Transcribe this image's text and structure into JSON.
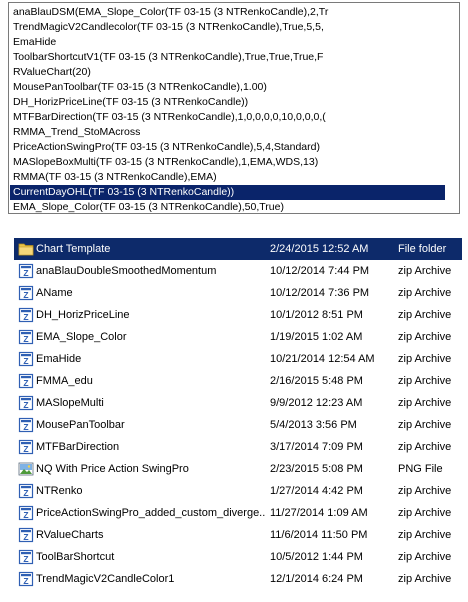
{
  "indicator_list": {
    "items": [
      "anaBlauDSM(EMA_Slope_Color(TF 03-15 (3 NTRenkoCandle),2,Tr",
      "TrendMagicV2Candlecolor(TF 03-15 (3 NTRenkoCandle),True,5,5,",
      "EmaHide",
      "ToolbarShortcutV1(TF 03-15 (3 NTRenkoCandle),True,True,True,F",
      "RValueChart(20)",
      "MousePanToolbar(TF 03-15 (3 NTRenkoCandle),1.00)",
      "DH_HorizPriceLine(TF 03-15 (3 NTRenkoCandle))",
      "MTFBarDirection(TF 03-15 (3 NTRenkoCandle),1,0,0,0,0,10,0,0,0,(",
      "RMMA_Trend_StoMAcross",
      "PriceActionSwingPro(TF 03-15 (3 NTRenkoCandle),5,4,Standard)",
      "MASlopeBoxMulti(TF 03-15 (3 NTRenkoCandle),1,EMA,WDS,13)",
      "RMMA(TF 03-15 (3 NTRenkoCandle),EMA)",
      "CurrentDayOHL(TF 03-15 (3 NTRenkoCandle))",
      "EMA_Slope_Color(TF 03-15 (3 NTRenkoCandle),50,True)"
    ],
    "selected_index": 12
  },
  "files": [
    {
      "name": "Chart Template",
      "date": "2/24/2015 12:52 AM",
      "type": "File folder",
      "icon": "folder-icon",
      "selected": true
    },
    {
      "name": "anaBlauDoubleSmoothedMomentum",
      "date": "10/12/2014 7:44 PM",
      "type": "zip Archive",
      "icon": "zip-archive-icon"
    },
    {
      "name": "AName",
      "date": "10/12/2014 7:36 PM",
      "type": "zip Archive",
      "icon": "zip-archive-icon"
    },
    {
      "name": "DH_HorizPriceLine",
      "date": "10/1/2012 8:51 PM",
      "type": "zip Archive",
      "icon": "zip-archive-icon"
    },
    {
      "name": "EMA_Slope_Color",
      "date": "1/19/2015 1:02 AM",
      "type": "zip Archive",
      "icon": "zip-archive-icon"
    },
    {
      "name": "EmaHide",
      "date": "10/21/2014 12:54 AM",
      "type": "zip Archive",
      "icon": "zip-archive-icon"
    },
    {
      "name": "FMMA_edu",
      "date": "2/16/2015 5:48 PM",
      "type": "zip Archive",
      "icon": "zip-archive-icon"
    },
    {
      "name": "MASlopeMulti",
      "date": "9/9/2012 12:23 AM",
      "type": "zip Archive",
      "icon": "zip-archive-icon"
    },
    {
      "name": "MousePanToolbar",
      "date": "5/4/2013 3:56 PM",
      "type": "zip Archive",
      "icon": "zip-archive-icon"
    },
    {
      "name": "MTFBarDirection",
      "date": "3/17/2014 7:09 PM",
      "type": "zip Archive",
      "icon": "zip-archive-icon"
    },
    {
      "name": "NQ With Price Action SwingPro",
      "date": "2/23/2015 5:08 PM",
      "type": "PNG File",
      "icon": "png-image-icon"
    },
    {
      "name": "NTRenko",
      "date": "1/27/2014 4:42 PM",
      "type": "zip Archive",
      "icon": "zip-archive-icon"
    },
    {
      "name": "PriceActionSwingPro_added_custom_diverge...",
      "date": "11/27/2014 1:09 AM",
      "type": "zip Archive",
      "icon": "zip-archive-icon"
    },
    {
      "name": "RValueCharts",
      "date": "11/6/2014 11:50 PM",
      "type": "zip Archive",
      "icon": "zip-archive-icon"
    },
    {
      "name": "ToolBarShortcut",
      "date": "10/5/2012 1:44 PM",
      "type": "zip Archive",
      "icon": "zip-archive-icon"
    },
    {
      "name": "TrendMagicV2CandleColor1",
      "date": "12/1/2014 6:24 PM",
      "type": "zip Archive",
      "icon": "zip-archive-icon"
    }
  ],
  "colors": {
    "selection": "#0a246a",
    "folder_yellow": "#e8c34a",
    "zip_blue": "#2f5fb3"
  }
}
